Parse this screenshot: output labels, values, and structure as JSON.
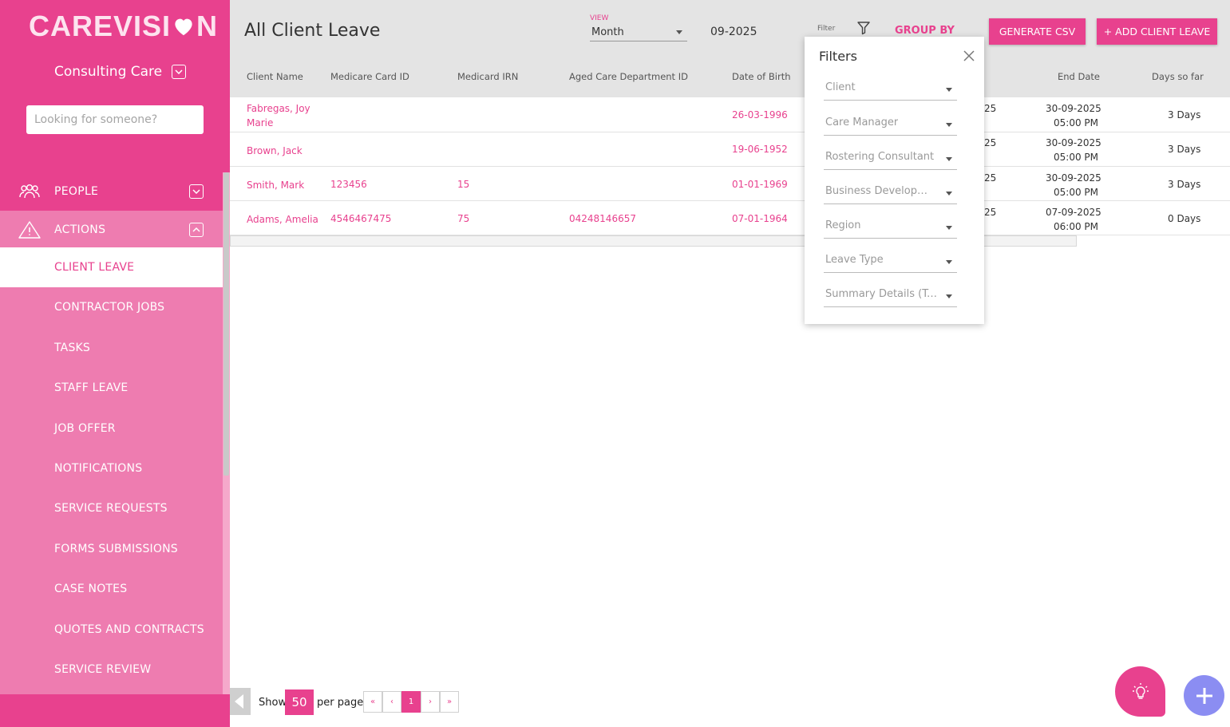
{
  "brand": {
    "logo_before": "CAREVISI",
    "logo_after": "N",
    "org_name": "Consulting Care",
    "colors": {
      "primary": "#e8418e",
      "nav_bg": "#ee7cb0",
      "fab_secondary": "#8b8df2"
    }
  },
  "search": {
    "placeholder": "Looking for someone?"
  },
  "sidebar": {
    "sections": [
      {
        "label": "PEOPLE",
        "icon": "people-icon",
        "expanded": false
      },
      {
        "label": "ACTIONS",
        "icon": "warning-icon",
        "expanded": true
      }
    ],
    "items": [
      {
        "label": "CLIENT LEAVE",
        "active": true
      },
      {
        "label": "CONTRACTOR JOBS"
      },
      {
        "label": "TASKS"
      },
      {
        "label": "STAFF LEAVE"
      },
      {
        "label": "JOB OFFER"
      },
      {
        "label": "NOTIFICATIONS"
      },
      {
        "label": "SERVICE REQUESTS"
      },
      {
        "label": "FORMS SUBMISSIONS"
      },
      {
        "label": "CASE NOTES"
      },
      {
        "label": "QUOTES AND CONTRACTS"
      },
      {
        "label": "SERVICE REVIEW"
      }
    ]
  },
  "header": {
    "title": "All Client Leave",
    "view_label": "VIEW",
    "view_value": "Month",
    "date_value": "09-2025",
    "filter_label": "Filter",
    "group_by": "GROUP BY",
    "csv_button": "GENERATE CSV",
    "add_button": "+ ADD CLIENT LEAVE"
  },
  "table": {
    "columns": {
      "client_name": "Client Name",
      "medicare_card_id": "Medicare Card ID",
      "medicard_irn": "Medicard IRN",
      "aged_care_id": "Aged Care Department ID",
      "dob": "Date of Birth",
      "end_date": "End Date",
      "days_so_far": "Days so far"
    },
    "rows": [
      {
        "name_l1": "Fabregas, Joy",
        "name_l2": "Marie",
        "card": "",
        "irn": "",
        "aged": "",
        "dob": "26-03-1996",
        "start_partial": "25",
        "end_date": "30-09-2025",
        "end_time": "05:00 PM",
        "days": "3 Days"
      },
      {
        "name_l1": "Brown, Jack",
        "name_l2": "",
        "card": "",
        "irn": "",
        "aged": "",
        "dob": "19-06-1952",
        "start_partial": "25",
        "end_date": "30-09-2025",
        "end_time": "05:00 PM",
        "days": "3 Days"
      },
      {
        "name_l1": "Smith, Mark",
        "name_l2": "",
        "card": "123456",
        "irn": "15",
        "aged": "",
        "dob": "01-01-1969",
        "start_partial": "25",
        "end_date": "30-09-2025",
        "end_time": "05:00 PM",
        "days": "3 Days"
      },
      {
        "name_l1": "Adams, Amelia",
        "name_l2": "",
        "card": "4546467475",
        "irn": "75",
        "aged": "04248146657",
        "dob": "07-01-1964",
        "start_partial": "25",
        "end_date": "07-09-2025",
        "end_time": "06:00 PM",
        "days": "0 Days"
      }
    ]
  },
  "filters": {
    "title": "Filters",
    "fields": [
      "Client",
      "Care Manager",
      "Rostering Consultant",
      "Business Development",
      "Region",
      "Leave Type",
      "Summary Details (Total)"
    ]
  },
  "pagination": {
    "show_label": "Show",
    "per_page_value": "50",
    "per_page_label": "per page",
    "first": "«",
    "prev": "‹",
    "current": "1",
    "next": "›",
    "last": "»"
  }
}
